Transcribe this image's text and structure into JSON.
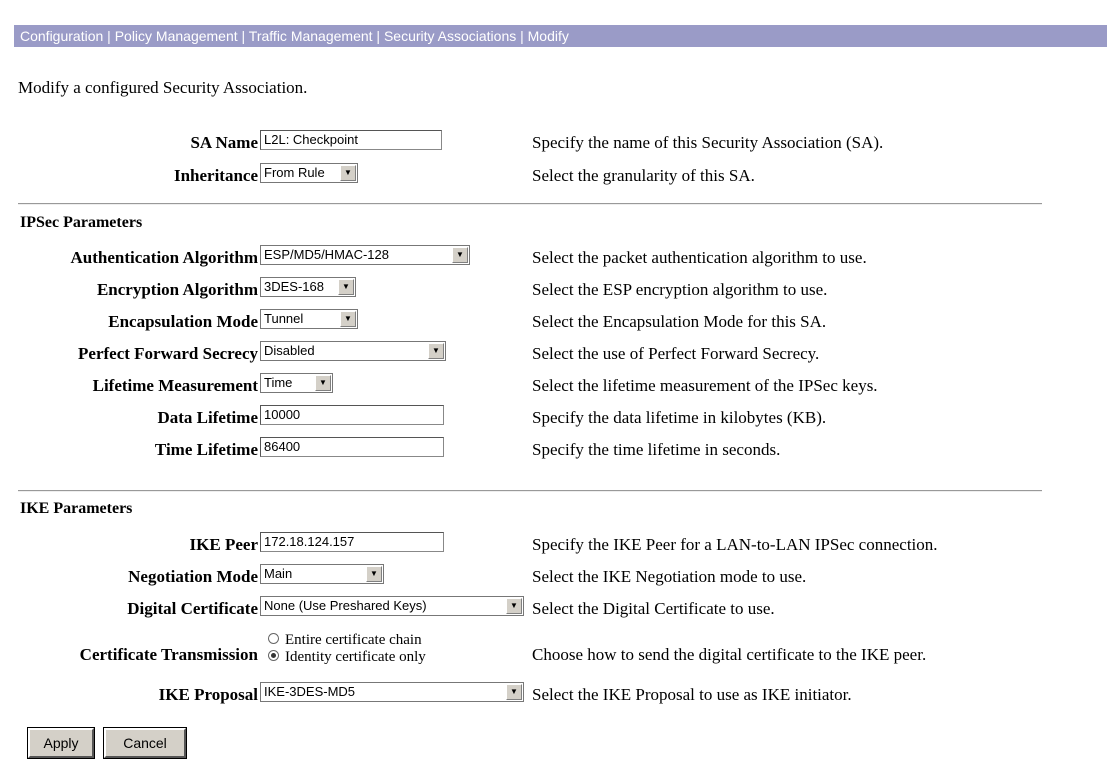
{
  "breadcrumb": "Configuration | Policy Management | Traffic Management | Security Associations | Modify",
  "intro": "Modify a configured Security Association.",
  "general": {
    "sa_name": {
      "label": "SA Name",
      "value": "L2L: Checkpoint",
      "help": "Specify the name of this Security Association (SA)."
    },
    "inheritance": {
      "label": "Inheritance",
      "value": "From Rule",
      "help": "Select the granularity of this SA."
    }
  },
  "ipsec": {
    "heading": "IPSec Parameters",
    "auth_alg": {
      "label": "Authentication Algorithm",
      "value": "ESP/MD5/HMAC-128",
      "help": "Select the packet authentication algorithm to use."
    },
    "enc_alg": {
      "label": "Encryption Algorithm",
      "value": "3DES-168",
      "help": "Select the ESP encryption algorithm to use."
    },
    "encap_mode": {
      "label": "Encapsulation Mode",
      "value": "Tunnel",
      "help": "Select the Encapsulation Mode for this SA."
    },
    "pfs": {
      "label": "Perfect Forward Secrecy",
      "value": "Disabled",
      "help": "Select the use of Perfect Forward Secrecy."
    },
    "lifetime_meas": {
      "label": "Lifetime Measurement",
      "value": "Time",
      "help": "Select the lifetime measurement of the IPSec keys."
    },
    "data_lifetime": {
      "label": "Data Lifetime",
      "value": "10000",
      "help": "Specify the data lifetime in kilobytes (KB)."
    },
    "time_lifetime": {
      "label": "Time Lifetime",
      "value": "86400",
      "help": "Specify the time lifetime in seconds."
    }
  },
  "ike": {
    "heading": "IKE Parameters",
    "peer": {
      "label": "IKE Peer",
      "value": "172.18.124.157",
      "help": "Specify the IKE Peer for a LAN-to-LAN IPSec connection."
    },
    "neg_mode": {
      "label": "Negotiation Mode",
      "value": "Main",
      "help": "Select the IKE Negotiation mode to use."
    },
    "cert": {
      "label": "Digital Certificate",
      "value": "None (Use Preshared Keys)",
      "help": "Select the Digital Certificate to use."
    },
    "cert_trans": {
      "label": "Certificate Transmission",
      "option1": "Entire certificate chain",
      "option2": "Identity certificate only",
      "selected": "option2",
      "help": "Choose how to send the digital certificate to the IKE peer."
    },
    "proposal": {
      "label": "IKE Proposal",
      "value": "IKE-3DES-MD5",
      "help": "Select the IKE Proposal to use as IKE initiator."
    }
  },
  "buttons": {
    "apply": "Apply",
    "cancel": "Cancel"
  }
}
